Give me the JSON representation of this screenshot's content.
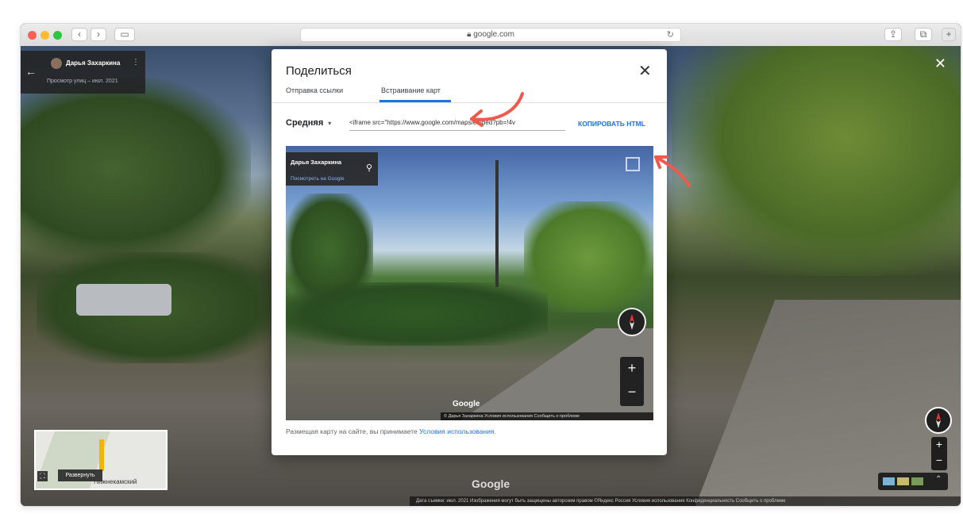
{
  "browser": {
    "url": "google.com",
    "traffic_colors": [
      "#fe5f57",
      "#febb2e",
      "#28c840"
    ]
  },
  "streetview": {
    "contributor_name": "Дарья Захаркина",
    "contributor_subtitle": "Просмотр улиц – июл. 2021",
    "minimap_expand_label": "Развернуть",
    "minimap_city_label": "Нижнекамский",
    "google_logo": "Google",
    "footer_text": "Дата съемки: июл. 2021   Изображения могут быть защищены авторским правом   ©Яндекс   Россия   Условия использования   Конфиденциальность   Сообщить о проблеме"
  },
  "share_dialog": {
    "title": "Поделиться",
    "tabs": [
      {
        "label": "Отправка ссылки",
        "active": false
      },
      {
        "label": "Встраивание карт",
        "active": true
      }
    ],
    "size_select": "Средняя",
    "embed_code": "<iframe src=\"https://www.google.com/maps/embed?pb=!4v",
    "copy_label": "КОПИРОВАТЬ HTML",
    "preview": {
      "contributor_name": "Дарья Захаркина",
      "view_link": "Посмотреть на Google",
      "google_logo": "Google",
      "footer_text": "© Дарья Захаркина   Условия использования   Сообщить о проблеме"
    },
    "terms_prefix": "Размещая карту на сайте, вы принимаете ",
    "terms_link": "Условия использования."
  },
  "colors": {
    "accent": "#1a73e8",
    "annotation_arrow": "#ef5a4c"
  }
}
